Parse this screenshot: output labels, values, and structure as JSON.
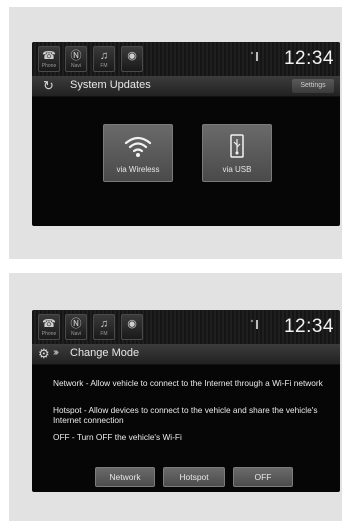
{
  "colors": {
    "screen_bg": "#060606",
    "button_bg": "#5a5a5a",
    "text": "#ececec"
  },
  "screens": [
    {
      "status": {
        "buttons": [
          {
            "label": "Phone",
            "icon": "phone-icon",
            "glyph": "☎"
          },
          {
            "label": "Navi",
            "icon": "navigation-icon",
            "glyph": "Ⓝ"
          },
          {
            "label": "FM",
            "icon": "radio-icon",
            "glyph": "♫"
          },
          {
            "label": "",
            "icon": "app-icon",
            "glyph": "◉"
          }
        ],
        "clock": "12:34"
      },
      "title": "System Updates",
      "settings_label": "Settings",
      "tiles": [
        {
          "label": "via Wireless",
          "icon": "wifi-icon"
        },
        {
          "label": "via USB",
          "icon": "usb-icon"
        }
      ]
    },
    {
      "status": {
        "buttons": [
          {
            "label": "Phone",
            "icon": "phone-icon",
            "glyph": "☎"
          },
          {
            "label": "Navi",
            "icon": "navigation-icon",
            "glyph": "Ⓝ"
          },
          {
            "label": "FM",
            "icon": "radio-icon",
            "glyph": "♫"
          },
          {
            "label": "",
            "icon": "app-icon",
            "glyph": "◉"
          }
        ],
        "clock": "12:34"
      },
      "title": "Change Mode",
      "descriptions": [
        "Network - Allow vehicle to connect to the Internet through a Wi-Fi network",
        "Hotspot - Allow devices to connect to the vehicle and share the vehicle's Internet connection",
        "OFF - Turn OFF the vehicle's Wi-Fi"
      ],
      "options": [
        "Network",
        "Hotspot",
        "OFF"
      ]
    }
  ]
}
